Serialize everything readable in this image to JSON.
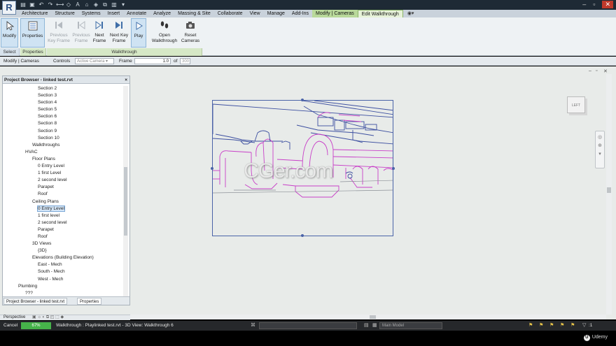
{
  "app": {
    "logo": "R"
  },
  "ribbon_tabs": [
    "Architecture",
    "Structure",
    "Systems",
    "Insert",
    "Annotate",
    "Analyze",
    "Massing & Site",
    "Collaborate",
    "View",
    "Manage",
    "Add-Ins",
    "Modify | Cameras",
    "Edit Walkthrough"
  ],
  "ribbon": {
    "modify": "Modify",
    "properties": "Properties",
    "previous_key_frame": "Previous Key Frame",
    "previous_frame": "Previous Frame",
    "next_frame": "Next Frame",
    "next_key_frame": "Next Key Frame",
    "play": "Play",
    "open_walkthrough": "Open Walkthrough",
    "reset_cameras": "Reset Cameras",
    "panel_select": "Select",
    "panel_properties": "Properties",
    "panel_walkthrough": "Walkthrough"
  },
  "options_bar": {
    "context": "Modify | Cameras",
    "controls_label": "Controls",
    "controls_value": "Active Camera",
    "frame_label": "Frame",
    "frame_value": "1.0",
    "of_label": "of",
    "total_frames": "300"
  },
  "project_browser": {
    "title": "Project Browser - linked test.rvt",
    "close": "×",
    "items": [
      "Section 2",
      "Section 3",
      "Section 4",
      "Section 5",
      "Section 6",
      "Section 8",
      "Section 9",
      "Section 10",
      "Walkthroughs",
      "HVAC",
      "Floor Plans",
      "0 Entry Level",
      "1 first Level",
      "2 second level",
      "Parapet",
      "Roof",
      "Ceiling Plans",
      "0 Entry Level",
      "1 first level",
      "2 second level",
      "Parapet",
      "Roof",
      "3D Views",
      "{3D}",
      "Elevations (Building Elevation)",
      "East - Mech",
      "South - Mech",
      "West - Mech",
      "Plumbing",
      "???"
    ],
    "tab_browser": "Project Browser - linked test.rvt",
    "tab_properties": "Properties"
  },
  "viewcube": {
    "label": "LEFT"
  },
  "watermark": "CGer.com",
  "view_bar": {
    "label": "Perspective"
  },
  "status_bar": {
    "cancel": "Cancel",
    "progress_text": "67%",
    "progress_value": 0.67,
    "message": "Walkthrough : Playlinked test.rvt - 3D View: Walkthrough 6",
    "model_value": "Main Model",
    "filter_value": ":1"
  },
  "footer": {
    "brand": "Udemy"
  },
  "colors": {
    "ribbon_context": "#b9d99b",
    "progress": "#46b34a",
    "crop": "#4a63a8",
    "magenta": "#c83fc8"
  }
}
